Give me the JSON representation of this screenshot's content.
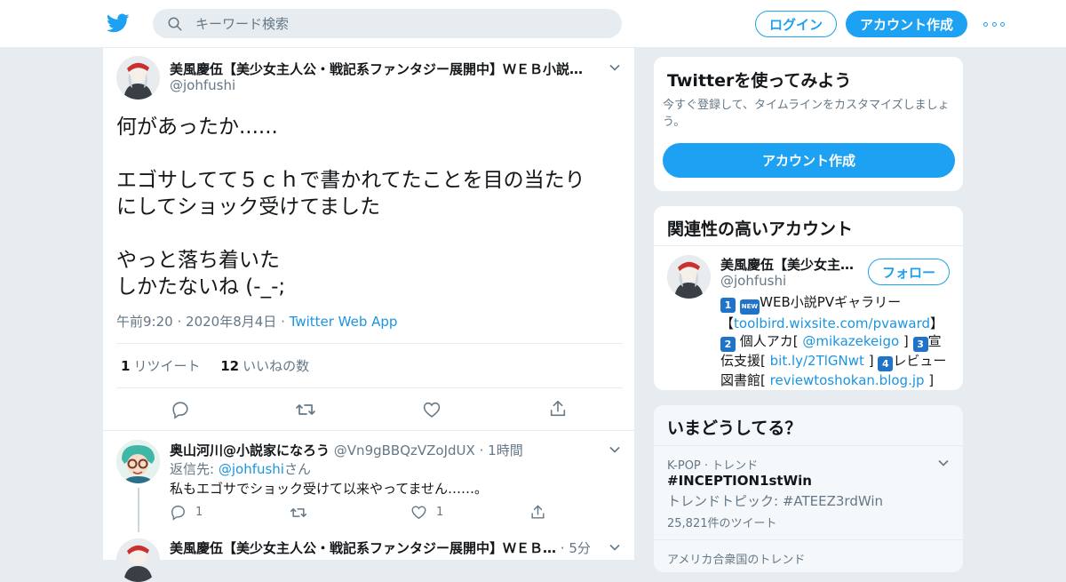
{
  "colors": {
    "brand": "#1da1f2",
    "link": "#1b95e0",
    "muted": "#657786"
  },
  "header": {
    "search_placeholder": "キーワード検索",
    "login_label": "ログイン",
    "signup_label": "アカウント作成"
  },
  "tweet": {
    "author_name": "美風慶伍【美少女主人公・戦記系ファンタジー展開中】ＷＥＢ小説…",
    "author_handle": "@johfushi",
    "text": "何があったか......\n\nエゴサしてて５ｃｈで書かれてたことを目の当たり\nにしてショック受けてました\n\nやっと落ち着いた\nしかたないね (-_-;",
    "time": "午前9:20",
    "date": "2020年8月4日",
    "dot": "·",
    "via": "Twitter Web App",
    "retweet_count": "1",
    "retweet_label": "リツイート",
    "like_count": "12",
    "like_label": "いいねの数"
  },
  "reply1": {
    "name": "奥山河川@小説家になろう",
    "handle": "@Vn9gBBQzVZoJdUX",
    "dot": "·",
    "time": "1時間",
    "reply_prefix": "返信先:",
    "reply_to": "@johfushi",
    "reply_suffix": "さん",
    "text": "私もエゴサでショック受けて以来やってません……。",
    "reply_count": "1",
    "retweet_count": "",
    "like_count": "1"
  },
  "reply2": {
    "name": "美風慶伍【美少女主人公・戦記系ファンタジー展開中】ＷＥＢ…",
    "dot": "·",
    "time": "5分"
  },
  "signup_card": {
    "title": "Twitterを使ってみよう",
    "subtitle": "今すぐ登録して、タイムラインをカスタマイズしましょう。",
    "button": "アカウント作成"
  },
  "related": {
    "title": "関連性の高いアカウント",
    "name": "美風慶伍【美少女主…",
    "handle": "@johfushi",
    "follow_label": "フォロー",
    "bio": {
      "k1": "1",
      "k_new": "NEW",
      "part1": "WEB小説PVギャラリー【",
      "link1": "toolbird.wixsite.com/pvaward",
      "part2": "】",
      "k2": "2",
      "part3": "個人アカ[ ",
      "link2": "@mikazekeigo",
      "part4": " ]",
      "k3": "3",
      "part5": "宣伝支援[ ",
      "link3": "bit.ly/2TlGNwt",
      "part6": " ]",
      "k4": "4",
      "part7": "レビュー図書館[ ",
      "link4": "reviewtoshokan.blog.jp",
      "part8": " ]"
    }
  },
  "trends": {
    "title": "いまどうしてる？",
    "items": [
      {
        "meta": "K-POP · トレンド",
        "name": "#INCEPTION1stWin",
        "topic": "トレンドトピック: #ATEEZ3rdWin",
        "count": "25,821件のツイート"
      },
      {
        "meta": "アメリカ合衆国のトレンド"
      }
    ]
  }
}
